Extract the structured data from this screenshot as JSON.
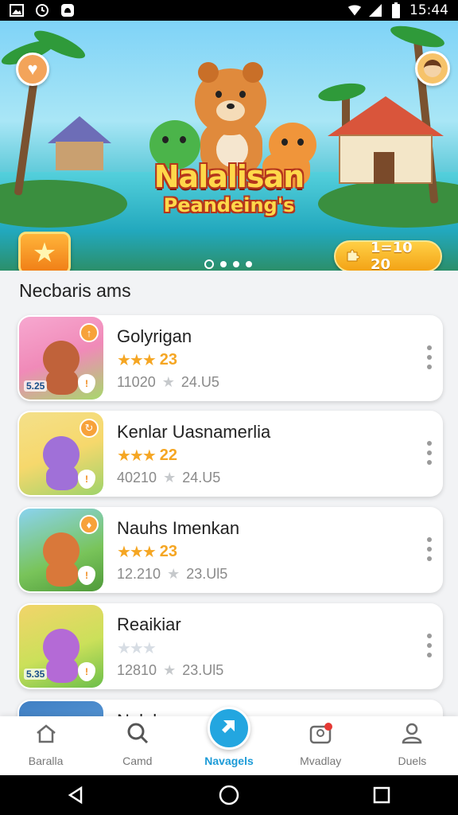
{
  "status_bar": {
    "time": "15:44",
    "left_icons": [
      "gallery-icon",
      "clock-icon",
      "notification-icon"
    ],
    "right_icons": [
      "wifi-icon",
      "signal-icon",
      "battery-icon"
    ]
  },
  "hero": {
    "title": "Nalalisan",
    "subtitle": "Peandeing's",
    "coin_value": "1=10 20",
    "pager": {
      "count": 4,
      "active_index": 0
    },
    "colors": {
      "sky": "#7fd3f7",
      "title": "#ffd84a",
      "title_outline": "#b5361c",
      "coin": "#f3a316"
    }
  },
  "section": {
    "title": "Necbaris ams"
  },
  "games": [
    {
      "name": "Golyrigan",
      "stars_filled": 3,
      "rating": "23",
      "downloads": "11020",
      "size": "24.U5",
      "price_tag": "5.25",
      "thumb_color": "#f08ab8",
      "critter_color": "#c0623a"
    },
    {
      "name": "Kenlar Uasnamerlia",
      "stars_filled": 3,
      "rating": "22",
      "downloads": "40210",
      "size": "24.U5",
      "price_tag": "",
      "thumb_color": "#f6d86c",
      "critter_color": "#a070d8"
    },
    {
      "name": "Nauhs Imenkan",
      "stars_filled": 3,
      "rating": "23",
      "downloads": "12.210",
      "size": "23.Ul5",
      "price_tag": "",
      "thumb_color": "#79c45a",
      "critter_color": "#d9783a"
    },
    {
      "name": "Reaikiar",
      "stars_filled": 0,
      "rating": "",
      "downloads": "12810",
      "size": "23.Ul5",
      "price_tag": "5.35",
      "thumb_color": "#cbe05a",
      "critter_color": "#b46ad6"
    },
    {
      "name": "Nalale",
      "stars_filled": 0,
      "rating": "",
      "downloads": "",
      "size": "",
      "price_tag": "",
      "thumb_color": "#3f7fc4",
      "critter_color": "#e89b3a"
    }
  ],
  "bottom_nav": [
    {
      "label": "Baralla",
      "icon": "home-icon",
      "active": false
    },
    {
      "label": "Camd",
      "icon": "search-icon",
      "active": false
    },
    {
      "label": "Navagels",
      "icon": "navigate-icon",
      "active": true
    },
    {
      "label": "Mvadlay",
      "icon": "inbox-icon",
      "active": false,
      "badge": true
    },
    {
      "label": "Duels",
      "icon": "profile-icon",
      "active": false
    }
  ],
  "system_nav": [
    "back-icon",
    "home-circle-icon",
    "recents-icon"
  ]
}
